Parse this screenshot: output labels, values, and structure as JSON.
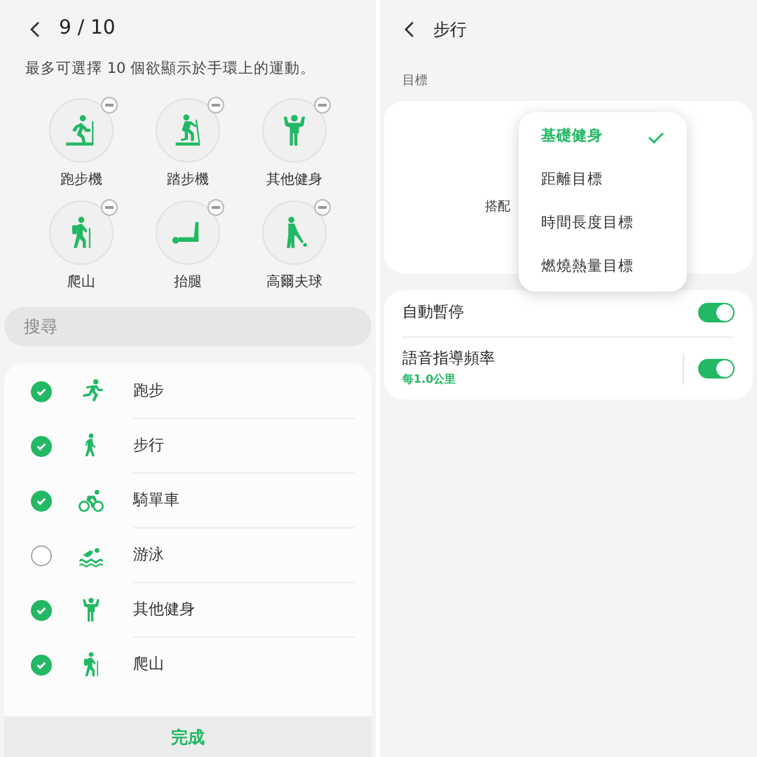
{
  "left": {
    "header": {
      "title": "9 / 10"
    },
    "description": "最多可選擇 10 個欲顯示於手環上的運動。",
    "selected_sports": [
      {
        "label": "跑步機",
        "kind": "treadmill"
      },
      {
        "label": "踏步機",
        "kind": "stepper"
      },
      {
        "label": "其他健身",
        "kind": "fitness"
      },
      {
        "label": "爬山",
        "kind": "hiking"
      },
      {
        "label": "抬腿",
        "kind": "legraise"
      },
      {
        "label": "高爾夫球",
        "kind": "golf"
      }
    ],
    "search": {
      "placeholder": "搜尋"
    },
    "sports": [
      {
        "label": "跑步",
        "kind": "run",
        "checked": true
      },
      {
        "label": "步行",
        "kind": "walk",
        "checked": true
      },
      {
        "label": "騎單車",
        "kind": "cycling",
        "checked": true
      },
      {
        "label": "游泳",
        "kind": "swim",
        "checked": false
      },
      {
        "label": "其他健身",
        "kind": "fitness",
        "checked": true
      },
      {
        "label": "爬山",
        "kind": "hiking",
        "checked": true
      }
    ],
    "done_button": "完成"
  },
  "right": {
    "header": {
      "title": "步行"
    },
    "section_label": "目標",
    "goal_hint": "搭配",
    "goal_menu": [
      {
        "label": "基礎健身",
        "selected": true
      },
      {
        "label": "距離目標",
        "selected": false
      },
      {
        "label": "時間長度目標",
        "selected": false
      },
      {
        "label": "燃燒熱量目標",
        "selected": false
      }
    ],
    "settings": [
      {
        "label": "自動暫停",
        "on": true
      },
      {
        "label": "語音指導頻率",
        "sublabel": "每1.0公里",
        "on": true
      }
    ]
  }
}
